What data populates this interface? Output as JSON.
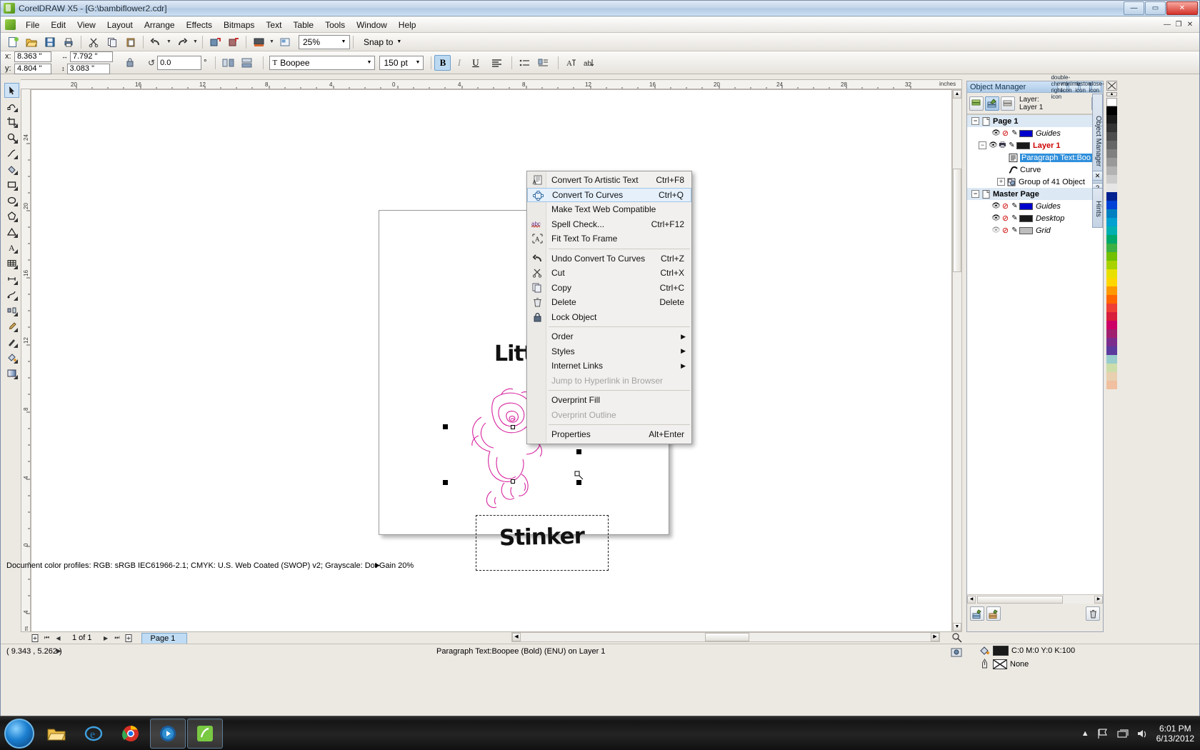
{
  "window": {
    "title": "CorelDRAW X5 - [G:\\bambiflower2.cdr]",
    "minimize": "—",
    "maximize": "▭",
    "close": "✕",
    "inner_minimize": "—",
    "inner_restore": "❐",
    "inner_close": "✕"
  },
  "menubar": {
    "items": [
      "File",
      "Edit",
      "View",
      "Layout",
      "Arrange",
      "Effects",
      "Bitmaps",
      "Text",
      "Table",
      "Tools",
      "Window",
      "Help"
    ]
  },
  "toolbar": {
    "new_icon": "new-document-icon",
    "open_icon": "open-folder-icon",
    "save_icon": "save-disk-icon",
    "print_icon": "print-icon",
    "cut_icon": "scissors-icon",
    "copy_icon": "copy-icon",
    "paste_icon": "paste-icon",
    "undo_icon": "undo-arrow-icon",
    "redo_icon": "redo-arrow-icon",
    "import_icon": "import-icon",
    "export_icon": "export-icon",
    "app_launcher_icon": "application-launcher-icon",
    "zoom_level": "25%",
    "snap_to": "Snap to"
  },
  "propbar": {
    "x_label": "x:",
    "x_value": "8.363 \"",
    "y_label": "y:",
    "y_value": "4.804 \"",
    "width_value": "7.792 \"",
    "height_value": "3.083 \"",
    "lock_icon": "lock-ratio-icon",
    "rotation_value": "0.0",
    "rotation_unit": "°",
    "mirror_h_icon": "mirror-horizontal-icon",
    "mirror_v_icon": "mirror-vertical-icon",
    "font_name": "Boopee",
    "font_size": "150 pt",
    "bold": "B",
    "italic": "I",
    "underline": "U",
    "align_icon": "text-align-icon",
    "bullet_icon": "bulleted-list-icon",
    "dropcap_icon": "drop-cap-icon",
    "char_format_icon": "character-formatting-icon",
    "text_direction_icon": "text-direction-icon"
  },
  "rulers": {
    "unit": "inches",
    "h_ticks": [
      "20",
      "16",
      "12",
      "8",
      "4",
      "0",
      "4",
      "8",
      "12",
      "16",
      "20",
      "24",
      "28",
      "32"
    ],
    "v_ticks": [
      "24",
      "20",
      "16",
      "12",
      "8",
      "4",
      "0",
      "4"
    ]
  },
  "toolbox": {
    "tools": [
      "pick-tool",
      "shape-tool",
      "crop-tool",
      "zoom-tool",
      "freehand-tool",
      "smart-fill-tool",
      "rectangle-tool",
      "ellipse-tool",
      "polygon-tool",
      "basic-shapes-tool",
      "text-tool",
      "table-tool",
      "dimension-tool",
      "connector-tool",
      "blend-tool",
      "color-eyedropper-tool",
      "outline-tool",
      "fill-tool",
      "interactive-fill-tool"
    ]
  },
  "canvas": {
    "artwork_title": "Little",
    "artwork_subtitle": "Stinker",
    "illustration": "line-art-skunk-drawing"
  },
  "context_menu": {
    "items": [
      {
        "label": "Convert To Artistic Text",
        "underline": "v",
        "shortcut": "Ctrl+F8",
        "icon": "convert-artistic-text-icon",
        "state": "normal"
      },
      {
        "label": "Convert To Curves",
        "underline": "v",
        "shortcut": "Ctrl+Q",
        "icon": "convert-to-curves-icon",
        "state": "selected"
      },
      {
        "label": "Make Text Web Compatible",
        "underline": "M",
        "shortcut": "",
        "icon": "",
        "state": "normal"
      },
      {
        "label": "Spell Check...",
        "underline": "S",
        "shortcut": "Ctrl+F12",
        "icon": "spell-check-abc-icon",
        "state": "normal"
      },
      {
        "label": "Fit Text To Frame",
        "underline": "i",
        "shortcut": "",
        "icon": "fit-text-frame-icon",
        "state": "normal"
      },
      {
        "separator": true
      },
      {
        "label": "Undo Convert To Curves",
        "underline": "U",
        "shortcut": "Ctrl+Z",
        "icon": "undo-arrow-icon",
        "state": "normal"
      },
      {
        "label": "Cut",
        "underline": "t",
        "shortcut": "Ctrl+X",
        "icon": "scissors-icon",
        "state": "normal"
      },
      {
        "label": "Copy",
        "underline": "C",
        "shortcut": "Ctrl+C",
        "icon": "copy-icon",
        "state": "normal"
      },
      {
        "label": "Delete",
        "underline": "l",
        "shortcut": "Delete",
        "icon": "trash-icon",
        "state": "normal"
      },
      {
        "label": "Lock Object",
        "underline": "L",
        "shortcut": "",
        "icon": "padlock-icon",
        "state": "normal"
      },
      {
        "separator": true
      },
      {
        "label": "Order",
        "underline": "O",
        "shortcut": "",
        "icon": "",
        "state": "submenu"
      },
      {
        "label": "Styles",
        "underline": "S",
        "shortcut": "",
        "icon": "",
        "state": "submenu"
      },
      {
        "label": "Internet Links",
        "underline": "n",
        "shortcut": "",
        "icon": "",
        "state": "submenu"
      },
      {
        "label": "Jump to Hyperlink in Browser",
        "underline": "J",
        "shortcut": "",
        "icon": "",
        "state": "disabled"
      },
      {
        "separator": true
      },
      {
        "label": "Overprint Fill",
        "underline": "F",
        "shortcut": "",
        "icon": "",
        "state": "normal"
      },
      {
        "label": "Overprint Outline",
        "underline": "",
        "shortcut": "",
        "icon": "",
        "state": "disabled"
      },
      {
        "separator": true
      },
      {
        "label": "Properties",
        "underline": "P",
        "shortcut": "Alt+Enter",
        "icon": "",
        "state": "normal"
      }
    ]
  },
  "docker": {
    "title": "Object Manager",
    "collapse_icon": "double-chevron-right-icon",
    "minimize_icon": "minimize-icon",
    "restore_icon": "restore-icon",
    "close_icon": "close-icon",
    "buttons": [
      {
        "name": "show-object-properties",
        "icon": "layers-properties-icon",
        "active": false
      },
      {
        "name": "edit-across-layers",
        "icon": "edit-across-layers-icon",
        "active": true
      },
      {
        "name": "layer-manager-view",
        "icon": "layer-manager-icon",
        "active": false
      }
    ],
    "layer_label_line1": "Layer:",
    "layer_label_line2": "Layer 1",
    "layer_arrow_icon": "chevron-right-icon",
    "tree": [
      {
        "indent": 0,
        "expander": "−",
        "icon": "page-icon",
        "label": "Page 1",
        "style": "header"
      },
      {
        "indent": 1,
        "expander": "",
        "icon": "eye-icon",
        "noprint": true,
        "pen": true,
        "swatch": "#0000cc",
        "label": "Guides",
        "style": "italic"
      },
      {
        "indent": 1,
        "expander": "−",
        "icon": "eye-icon",
        "printer": true,
        "pen": true,
        "swatch": "#1a1a1a",
        "label": "Layer 1",
        "style": "red"
      },
      {
        "indent": 2,
        "expander": "",
        "icon": "paragraph-text-icon",
        "label": "Paragraph Text:Boo",
        "style": "selected"
      },
      {
        "indent": 2,
        "expander": "",
        "icon": "curve-icon",
        "label": "Curve",
        "style": "normal"
      },
      {
        "indent": 2,
        "expander": "+",
        "icon": "group-icon",
        "label": "Group of 41 Object",
        "style": "normal"
      },
      {
        "indent": 0,
        "expander": "−",
        "icon": "page-icon",
        "label": "Master Page",
        "style": "header"
      },
      {
        "indent": 1,
        "expander": "",
        "icon": "eye-icon",
        "noprint": true,
        "pen": true,
        "swatch": "#0000cc",
        "label": "Guides",
        "style": "italic"
      },
      {
        "indent": 1,
        "expander": "",
        "icon": "eye-icon",
        "noprint": true,
        "pen": true,
        "swatch": "#1a1a1a",
        "label": "Desktop",
        "style": "italic"
      },
      {
        "indent": 1,
        "expander": "",
        "icon": "eye-closed-icon",
        "noprint": true,
        "pen": true,
        "swatch": "#bdbdbd",
        "label": "Grid",
        "style": "italic"
      }
    ],
    "new_layer_icon": "new-layer-icon",
    "new_master_layer_icon": "new-master-layer-icon",
    "delete_icon": "trash-icon",
    "side_tab": "Object Manager",
    "side_tab_hints": "Hints"
  },
  "page_nav": {
    "add_page_start_icon": "add-page-icon",
    "first_icon": "⏮",
    "prev_icon": "◀",
    "counter": "1 of 1",
    "next_icon": "▶",
    "last_icon": "⏭",
    "add_page_end_icon": "add-page-icon",
    "tab_label": "Page 1"
  },
  "statusbar": {
    "coords": "( 9.343 , 5.262 )",
    "expander_icon": "▶",
    "object_info": "Paragraph Text:Boopee (Bold) (ENU) on Layer 1",
    "color_profiles": "Document color profiles: RGB: sRGB IEC61966-2.1; CMYK: U.S. Web Coated (SWOP) v2; Grayscale: Dot Gain 20%",
    "profiles_arrow": "▶",
    "fill_icon": "fill-bucket-icon",
    "fill_swatch": "#1a1a1a",
    "fill_value": "C:0 M:0 Y:0 K:100",
    "outline_icon": "outline-pen-icon",
    "outline_value": "None",
    "screen_capture_icon": "screen-capture-icon"
  },
  "palette": {
    "top_label": "✕",
    "colors": [
      "#ffffff",
      "#000000",
      "#1a1a1a",
      "#333333",
      "#4d4d4d",
      "#666666",
      "#808080",
      "#999999",
      "#b3b3b3",
      "#cccccc",
      "#e6e6e6",
      "#00218f",
      "#0042d6",
      "#0080c0",
      "#00a0d0",
      "#00b0b0",
      "#00a86b",
      "#3cb043",
      "#72c000",
      "#a8d200",
      "#e8e000",
      "#ffd700",
      "#ff9900",
      "#ff6600",
      "#ef3e36",
      "#d81e3b",
      "#cc0066",
      "#a02070",
      "#7b2d8e",
      "#5b3a9e",
      "#99cccc",
      "#ccddaa",
      "#e8d0b0",
      "#f0c0a0"
    ]
  },
  "taskbar": {
    "start_icon": "windows-start-orb",
    "apps": [
      {
        "name": "explorer-taskbar-icon",
        "glyph": "📁"
      },
      {
        "name": "internet-explorer-taskbar-icon",
        "glyph": "e"
      },
      {
        "name": "chrome-taskbar-icon",
        "glyph": "◉"
      },
      {
        "name": "media-player-taskbar-icon",
        "glyph": "▶"
      },
      {
        "name": "coreldraw-taskbar-icon",
        "glyph": "✎"
      }
    ],
    "tray": [
      "show-hidden-icons",
      "network-flag-icon",
      "network-icon",
      "volume-icon"
    ],
    "time": "6:01 PM",
    "date": "6/13/2012"
  }
}
